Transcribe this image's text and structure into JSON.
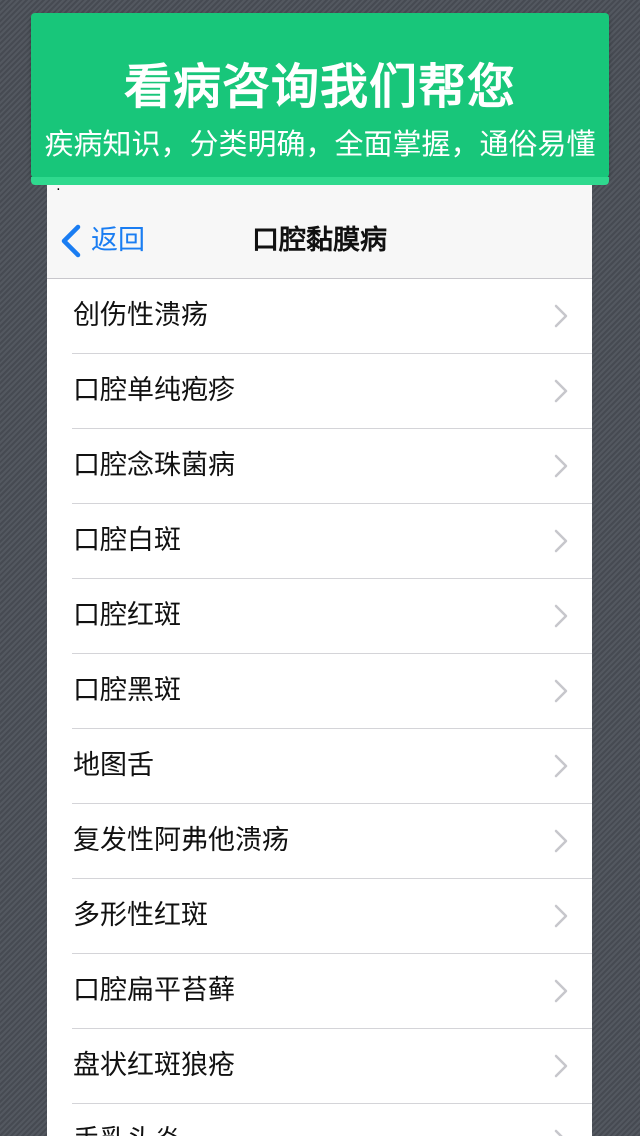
{
  "banner": {
    "title": "看病咨询我们帮您",
    "subtitle": "疾病知识，分类明确，全面掌握，通俗易懂"
  },
  "status_bar": {
    "text": ":"
  },
  "nav": {
    "back_label": "返回",
    "back_icon": "chevron-left-icon",
    "title": "口腔黏膜病"
  },
  "colors": {
    "banner_green": "#18c67a",
    "ios_blue": "#1a7df2",
    "chevron_gray": "#c7c7cc"
  },
  "list": {
    "row_icon": "chevron-right-icon",
    "items": [
      {
        "label": "创伤性溃疡"
      },
      {
        "label": "口腔单纯疱疹"
      },
      {
        "label": "口腔念珠菌病"
      },
      {
        "label": "口腔白斑"
      },
      {
        "label": "口腔红斑"
      },
      {
        "label": "口腔黑斑"
      },
      {
        "label": "地图舌"
      },
      {
        "label": "复发性阿弗他溃疡"
      },
      {
        "label": "多形性红斑"
      },
      {
        "label": "口腔扁平苔藓"
      },
      {
        "label": "盘状红斑狼疮"
      },
      {
        "label": "手乳头炎"
      }
    ]
  }
}
